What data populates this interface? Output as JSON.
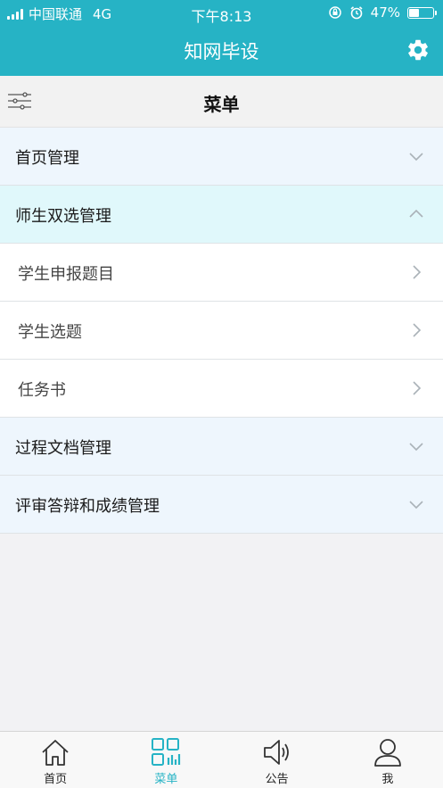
{
  "status_bar": {
    "carrier": "中国联通",
    "network": "4G",
    "time": "下午8:13",
    "battery_text": "47%",
    "battery_level": 0.47
  },
  "nav": {
    "title": "知网毕设",
    "settings_icon": "gear-icon"
  },
  "menu_header": {
    "title": "菜单",
    "filter_icon": "filter-sliders-icon"
  },
  "menu": [
    {
      "label": "首页管理",
      "type": "section",
      "state": "collapsed"
    },
    {
      "label": "师生双选管理",
      "type": "section",
      "state": "expanded"
    },
    {
      "label": "学生申报题目",
      "type": "sub"
    },
    {
      "label": "学生选题",
      "type": "sub"
    },
    {
      "label": "任务书",
      "type": "sub"
    },
    {
      "label": "过程文档管理",
      "type": "section",
      "state": "collapsed"
    },
    {
      "label": "评审答辩和成绩管理",
      "type": "section",
      "state": "collapsed"
    }
  ],
  "tabs": [
    {
      "label": "首页",
      "icon": "home-icon",
      "active": false
    },
    {
      "label": "菜单",
      "icon": "grid-menu-icon",
      "active": true
    },
    {
      "label": "公告",
      "icon": "speaker-icon",
      "active": false
    },
    {
      "label": "我",
      "icon": "user-icon",
      "active": false
    }
  ],
  "colors": {
    "accent": "#26b3c5",
    "section_bg": "#eef6fd",
    "expanded_bg": "#e0f8fb"
  }
}
